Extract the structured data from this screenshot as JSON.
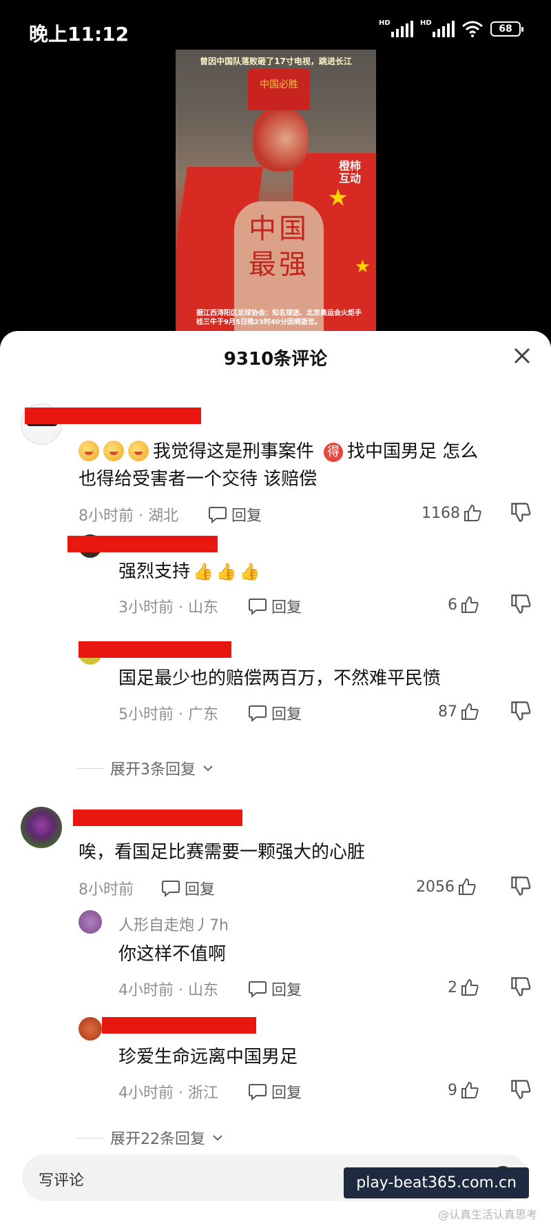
{
  "status_bar": {
    "time": "晚上11:12",
    "battery": "68"
  },
  "video": {
    "caption_top": "曾因中国队落败砸了17寸电视，跳进长江",
    "watermark": "橙柿\n互动",
    "hat_text": "中国必胜",
    "body_text": "中国最强",
    "caption_bottom": "据江西浔阳区足球协会：知名球迷、北京奥运会火炬手桂三牛于9月5日晚23时40分因病逝世。"
  },
  "sheet": {
    "title": "9310条评论"
  },
  "comments": [
    {
      "text_main": "我觉得这是刑事案件",
      "text_mid": "找中国男足  怎么",
      "text_line2": "也得给受害者一个交待  该赔偿",
      "badge": "得",
      "time": "8小时前 · 湖北",
      "reply": "回复",
      "likes": "1168",
      "replies": [
        {
          "text": "强烈支持",
          "time": "3小时前 · 山东",
          "reply": "回复",
          "likes": "6"
        },
        {
          "text": "国足最少也的赔偿两百万，不然难平民愤",
          "time": "5小时前 · 广东",
          "reply": "回复",
          "likes": "87"
        }
      ],
      "expand": "展开3条回复"
    },
    {
      "text": "唉，看国足比赛需要一颗强大的心脏",
      "time": "8小时前",
      "reply": "回复",
      "likes": "2056",
      "replies": [
        {
          "name": "人形自走炮丿7h",
          "text": "你这样不值啊",
          "time": "4小时前 · 山东",
          "reply": "回复",
          "likes": "2"
        },
        {
          "text": "珍爱生命远离中国男足",
          "time": "4小时前 · 浙江",
          "reply": "回复",
          "likes": "9"
        }
      ],
      "expand": "展开22条回复"
    }
  ],
  "input": {
    "placeholder": "写评论"
  },
  "watermark": {
    "site": "play-beat365.com.cn",
    "corner": "@认真生活认真思考"
  },
  "colors": {
    "redaction": "#e8170f",
    "sheet_bg": "#ffffff",
    "screen_bg": "#000000"
  }
}
